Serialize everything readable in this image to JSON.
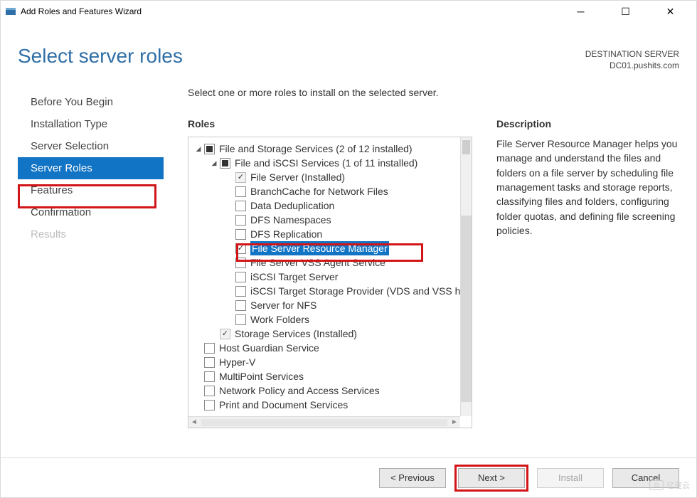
{
  "window": {
    "title": "Add Roles and Features Wizard"
  },
  "header": {
    "page_title": "Select server roles",
    "dest_label": "DESTINATION SERVER",
    "dest_value": "DC01.pushits.com"
  },
  "sidebar": {
    "items": [
      {
        "label": "Before You Begin",
        "state": "normal"
      },
      {
        "label": "Installation Type",
        "state": "normal"
      },
      {
        "label": "Server Selection",
        "state": "normal"
      },
      {
        "label": "Server Roles",
        "state": "active"
      },
      {
        "label": "Features",
        "state": "normal"
      },
      {
        "label": "Confirmation",
        "state": "normal"
      },
      {
        "label": "Results",
        "state": "disabled"
      }
    ]
  },
  "main": {
    "instruction": "Select one or more roles to install on the selected server.",
    "roles_heading": "Roles",
    "desc_heading": "Description",
    "description": "File Server Resource Manager helps you manage and understand the files and folders on a file server by scheduling file management tasks and storage reports, classifying files and folders, configuring folder quotas, and defining file screening policies."
  },
  "tree": [
    {
      "indent": 0,
      "caret": "down",
      "cbox": "mixed",
      "label": "File and Storage Services (2 of 12 installed)"
    },
    {
      "indent": 1,
      "caret": "down",
      "cbox": "mixed",
      "label": "File and iSCSI Services (1 of 11 installed)"
    },
    {
      "indent": 2,
      "caret": "",
      "cbox": "checked-disabled",
      "label": "File Server (Installed)"
    },
    {
      "indent": 2,
      "caret": "",
      "cbox": "empty",
      "label": "BranchCache for Network Files"
    },
    {
      "indent": 2,
      "caret": "",
      "cbox": "empty",
      "label": "Data Deduplication"
    },
    {
      "indent": 2,
      "caret": "",
      "cbox": "empty",
      "label": "DFS Namespaces"
    },
    {
      "indent": 2,
      "caret": "",
      "cbox": "empty",
      "label": "DFS Replication"
    },
    {
      "indent": 2,
      "caret": "",
      "cbox": "checked",
      "label": "File Server Resource Manager",
      "selected": true
    },
    {
      "indent": 2,
      "caret": "",
      "cbox": "empty",
      "label": "File Server VSS Agent Service"
    },
    {
      "indent": 2,
      "caret": "",
      "cbox": "empty",
      "label": "iSCSI Target Server"
    },
    {
      "indent": 2,
      "caret": "",
      "cbox": "empty",
      "label": "iSCSI Target Storage Provider (VDS and VSS hardware providers)"
    },
    {
      "indent": 2,
      "caret": "",
      "cbox": "empty",
      "label": "Server for NFS"
    },
    {
      "indent": 2,
      "caret": "",
      "cbox": "empty",
      "label": "Work Folders"
    },
    {
      "indent": 1,
      "caret": "",
      "cbox": "checked-disabled",
      "label": "Storage Services (Installed)"
    },
    {
      "indent": 0,
      "caret": "",
      "cbox": "empty",
      "label": "Host Guardian Service"
    },
    {
      "indent": 0,
      "caret": "",
      "cbox": "empty",
      "label": "Hyper-V"
    },
    {
      "indent": 0,
      "caret": "",
      "cbox": "empty",
      "label": "MultiPoint Services"
    },
    {
      "indent": 0,
      "caret": "",
      "cbox": "empty",
      "label": "Network Policy and Access Services"
    },
    {
      "indent": 0,
      "caret": "",
      "cbox": "empty",
      "label": "Print and Document Services"
    }
  ],
  "footer": {
    "previous": "< Previous",
    "next": "Next >",
    "install": "Install",
    "cancel": "Cancel"
  },
  "watermark": "亿速云"
}
